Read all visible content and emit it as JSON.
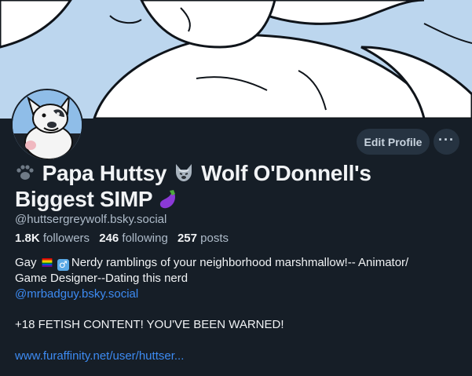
{
  "profile": {
    "display_name_part1": "Papa Huttsy",
    "display_name_part2": "Wolf O'Donnell's",
    "display_name_part3": "Biggest SIMP",
    "handle": "@huttsergreywolf.bsky.social",
    "followers_count": "1.8K",
    "followers_label": "followers",
    "following_count": "246",
    "following_label": "following",
    "posts_count": "257",
    "posts_label": "posts"
  },
  "bio": {
    "line1_a": "Gay",
    "line1_b": "Nerdy ramblings of your neighborhood marshmallow!-- Animator/",
    "line2": "Game Designer--Dating this nerd",
    "mention": "@mrbadguy.bsky.social",
    "warning": "+18 FETISH CONTENT! YOU'VE BEEN WARNED!",
    "website": "www.furaffinity.net/user/huttser..."
  },
  "actions": {
    "edit_profile": "Edit Profile",
    "more": "···"
  },
  "icons": {
    "paw": "paw-icon",
    "wolf": "wolf-icon",
    "eggplant": "eggplant-icon",
    "rainbow_flag": "rainbow-flag-icon",
    "male_sign": "male-sign-icon"
  },
  "colors": {
    "background": "#161e27",
    "link": "#3d8bf2",
    "button_bg": "#263341",
    "muted_text": "#aebbc9"
  }
}
